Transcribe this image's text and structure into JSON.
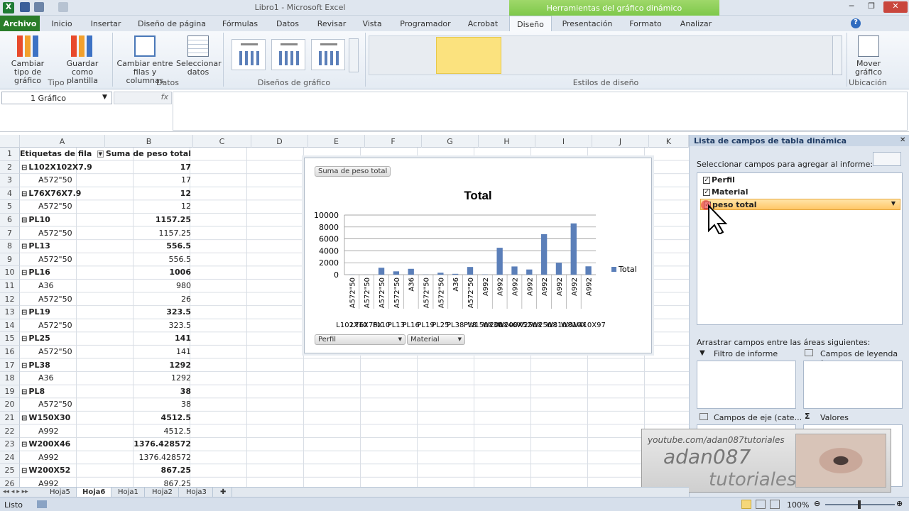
{
  "window": {
    "title": "Libro1  -  Microsoft Excel",
    "context_header": "Herramientas del gráfico dinámico"
  },
  "tabs": [
    "Archivo",
    "Inicio",
    "Insertar",
    "Diseño de página",
    "Fórmulas",
    "Datos",
    "Revisar",
    "Vista",
    "Programador",
    "Acrobat",
    "Diseño",
    "Presentación",
    "Formato",
    "Analizar"
  ],
  "ribbon": {
    "change_type": "Cambiar tipo de gráfico",
    "save_template": "Guardar como plantilla",
    "group_tipo": "Tipo",
    "switch_rows": "Cambiar entre filas y columnas",
    "select_data": "Seleccionar datos",
    "group_datos": "Datos",
    "group_layouts": "Diseños de gráfico",
    "group_styles": "Estilos de diseño",
    "move_chart": "Mover gráfico",
    "group_location": "Ubicación"
  },
  "formula_bar": {
    "name_box": "1 Gráfico",
    "fx": "fx"
  },
  "columns": [
    "A",
    "B",
    "C",
    "D",
    "E",
    "F",
    "G",
    "H",
    "I",
    "J",
    "K"
  ],
  "rows": [
    {
      "n": "1",
      "a": "Etiquetas de fila",
      "b": "Suma de peso total",
      "bold": true,
      "header": true
    },
    {
      "n": "2",
      "a": "L102X102X7.9",
      "b": "17",
      "bold": true,
      "group": true
    },
    {
      "n": "3",
      "a": "A572\"50",
      "b": "17"
    },
    {
      "n": "4",
      "a": "L76X76X7.9",
      "b": "12",
      "bold": true,
      "group": true
    },
    {
      "n": "5",
      "a": "A572\"50",
      "b": "12"
    },
    {
      "n": "6",
      "a": "PL10",
      "b": "1157.25",
      "bold": true,
      "group": true
    },
    {
      "n": "7",
      "a": "A572\"50",
      "b": "1157.25"
    },
    {
      "n": "8",
      "a": "PL13",
      "b": "556.5",
      "bold": true,
      "group": true
    },
    {
      "n": "9",
      "a": "A572\"50",
      "b": "556.5"
    },
    {
      "n": "10",
      "a": "PL16",
      "b": "1006",
      "bold": true,
      "group": true
    },
    {
      "n": "11",
      "a": "A36",
      "b": "980"
    },
    {
      "n": "12",
      "a": "A572\"50",
      "b": "26"
    },
    {
      "n": "13",
      "a": "PL19",
      "b": "323.5",
      "bold": true,
      "group": true
    },
    {
      "n": "14",
      "a": "A572\"50",
      "b": "323.5"
    },
    {
      "n": "15",
      "a": "PL25",
      "b": "141",
      "bold": true,
      "group": true
    },
    {
      "n": "16",
      "a": "A572\"50",
      "b": "141"
    },
    {
      "n": "17",
      "a": "PL38",
      "b": "1292",
      "bold": true,
      "group": true
    },
    {
      "n": "18",
      "a": "A36",
      "b": "1292"
    },
    {
      "n": "19",
      "a": "PL8",
      "b": "38",
      "bold": true,
      "group": true
    },
    {
      "n": "20",
      "a": "A572\"50",
      "b": "38"
    },
    {
      "n": "21",
      "a": "W150X30",
      "b": "4512.5",
      "bold": true,
      "group": true
    },
    {
      "n": "22",
      "a": "A992",
      "b": "4512.5"
    },
    {
      "n": "23",
      "a": "W200X46",
      "b": "1376.428572",
      "bold": true,
      "group": true
    },
    {
      "n": "24",
      "a": "A992",
      "b": "1376.428572"
    },
    {
      "n": "25",
      "a": "W200X52",
      "b": "867.25",
      "bold": true,
      "group": true
    },
    {
      "n": "26",
      "a": "A992",
      "b": "867.25"
    }
  ],
  "chart_data": {
    "type": "bar",
    "title": "Total",
    "value_field_button": "Suma de peso total",
    "axis_buttons": [
      "Perfil",
      "Material"
    ],
    "categories": [
      "A572\"50",
      "A572\"50",
      "A572\"50",
      "A572\"50",
      "A36",
      "A572\"50",
      "A572\"50",
      "A36",
      "A572\"50",
      "A992",
      "A992",
      "A992",
      "A992",
      "A992",
      "A992",
      "A992",
      "A992"
    ],
    "groups": [
      "L102X10",
      "L76X76X",
      "PL10",
      "PL13",
      "PL16",
      "PL19",
      "PL25",
      "PL38",
      "PL8",
      "W150X30",
      "W200X46",
      "W200X52",
      "W250X",
      "W250X",
      "W310X",
      "W310X",
      "W410X97"
    ],
    "series": [
      {
        "name": "Total",
        "values": [
          17,
          12,
          1157.25,
          556.5,
          980,
          26,
          323.5,
          141,
          1292,
          38,
          4512.5,
          1376.43,
          867.25,
          6800,
          2000,
          8600,
          1400
        ]
      }
    ],
    "ylim": [
      0,
      10000
    ],
    "yticks": [
      0,
      2000,
      4000,
      6000,
      8000,
      10000
    ],
    "legend": "right",
    "color": "#5b7fb9"
  },
  "pane": {
    "title": "Lista de campos de tabla dinámica",
    "select_label": "Seleccionar campos para agregar al informe:",
    "fields": [
      {
        "name": "Perfil",
        "checked": true
      },
      {
        "name": "Material",
        "checked": true
      },
      {
        "name": "peso total",
        "checked": true
      }
    ],
    "drag_label": "Arrastrar campos entre las áreas siguientes:",
    "report_filter": "Filtro de informe",
    "legend_fields": "Campos de leyenda (...",
    "axis_fields": "Campos de eje (cate...",
    "values": "Valores"
  },
  "sheets": [
    "Hoja5",
    "Hoja6",
    "Hoja1",
    "Hoja2",
    "Hoja3"
  ],
  "active_sheet": "Hoja6",
  "status": {
    "ready": "Listo",
    "zoom": "100%"
  },
  "watermark": {
    "url": "youtube.com/adan087tutoriales",
    "name": "adan087",
    "sub": "tutoriales"
  }
}
